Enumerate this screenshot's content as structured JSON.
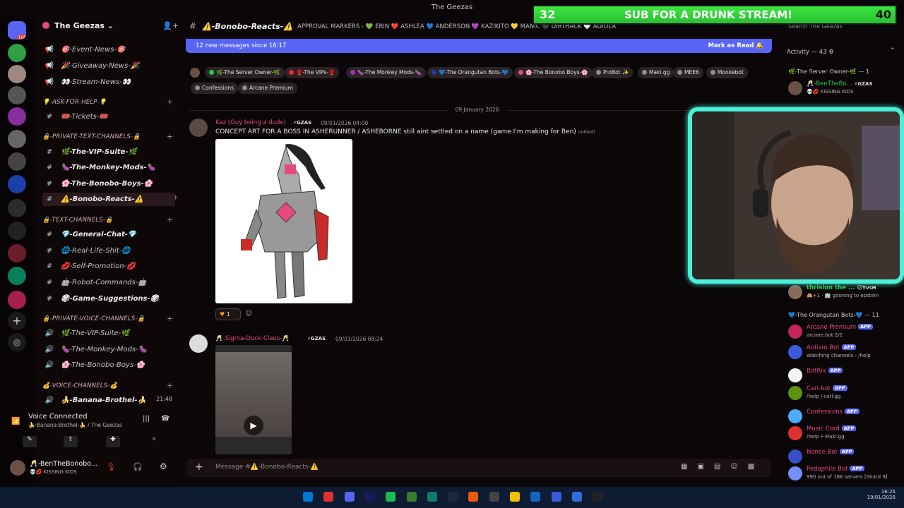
{
  "window_title": "The Geezas",
  "overlay": {
    "sub_left": "32",
    "sub_text": "SUB FOR A DRUNK STREAM!",
    "sub_right": "40"
  },
  "server": {
    "name": "The Geezas",
    "rail_badge": "108"
  },
  "sidebar": {
    "items": [
      {
        "type": "channel",
        "icon": "📢",
        "label": "🎯-Event-News-🎯",
        "dim": true
      },
      {
        "type": "channel",
        "icon": "📢",
        "label": "🎉-Giveaway-News-🎉",
        "dim": true
      },
      {
        "type": "channel",
        "icon": "📢",
        "label": "👀-Stream-News-👀",
        "dim": true
      },
      {
        "type": "category",
        "label": "💡-ASK-FOR-HELP-💡"
      },
      {
        "type": "channel",
        "icon": "#",
        "label": "🎟️-Tickets-🎟️",
        "dim": true
      },
      {
        "type": "category",
        "label": "🔒-PRIVATE-TEXT-CHANNELS-🔒"
      },
      {
        "type": "channel",
        "icon": "#",
        "label": "🌿-The-VIP-Suite-🌿"
      },
      {
        "type": "channel",
        "icon": "#",
        "label": "🍆-The-Monkey-Mods-🍆"
      },
      {
        "type": "channel",
        "icon": "#",
        "label": "🌸-The-Bonobo-Boys-🌸"
      },
      {
        "type": "channel",
        "icon": "#",
        "label": "⚠️-Bonobo-Reacts-⚠️",
        "active": true
      },
      {
        "type": "category",
        "label": "🔒-TEXT-CHANNELS-🔒"
      },
      {
        "type": "channel",
        "icon": "#",
        "label": "💎-General-Chat-💎"
      },
      {
        "type": "channel",
        "icon": "#",
        "label": "🌐-Real-Life-Shit-🌐",
        "dim": true
      },
      {
        "type": "channel",
        "icon": "#",
        "label": "💋-Self-Promotion-💋",
        "dim": true
      },
      {
        "type": "channel",
        "icon": "#",
        "label": "🤖-Robot-Commands-🤖",
        "dim": true
      },
      {
        "type": "channel",
        "icon": "#",
        "label": "🎲-Game-Suggestions-🎲"
      },
      {
        "type": "category",
        "label": "🔒-PRIVATE-VOICE-CHANNELS-🔒"
      },
      {
        "type": "channel",
        "icon": "🔊",
        "label": "🌿-The-VIP-Suite-🌿",
        "dim": true
      },
      {
        "type": "channel",
        "icon": "🔊",
        "label": "🍆-The-Monkey-Mods-🍆",
        "dim": true
      },
      {
        "type": "channel",
        "icon": "🔊",
        "label": "🌸-The-Bonobo-Boys-🌸",
        "dim": true
      },
      {
        "type": "category",
        "label": "💰-VOICE-CHANNELS-💰"
      },
      {
        "type": "channel",
        "icon": "🔊",
        "label": "🍌-Banana-Brothel-🍌"
      }
    ],
    "voice_time": "21:48"
  },
  "voice": {
    "status": "Voice Connected",
    "location": "🍌-Banana-Brothel-🍌 / The Geezas"
  },
  "user": {
    "name": "🥂-BenTheBonobo...",
    "status": "💀💋 KISSING KIDS"
  },
  "header": {
    "channel": "⚠️-Bonobo-Reacts-⚠️",
    "topic": "APPROVAL MARKERS - 💚 ERIN ❤️ ASHLEA 💙 ANDERSON 💜 KAZIKITO 💛 MANIC 🖤 DIRTHACK 🤍 ADIOLA",
    "search_placeholder": "Search The Geezas"
  },
  "new_messages": {
    "text": "12 new messages since 16:17",
    "action": "Mark as Read"
  },
  "role_pills": [
    {
      "label": "🌿-The Server Owner-🌿",
      "color": "#2dc653"
    },
    {
      "label": "🥊-The VIPs-🥊",
      "color": "#e03131"
    },
    {
      "label": "🍆-The Monkey Mods-🍆",
      "color": "#9c36b5"
    },
    {
      "label": "💙-The Orangutan Bots-💙",
      "color": "#1c3faa"
    },
    {
      "label": "🌸-The Bonobo Boys-🌸",
      "color": "#e64980"
    },
    {
      "label": "ProBot ✨",
      "color": "#868e96"
    },
    {
      "label": "Maki.gg",
      "color": "#868e96"
    },
    {
      "label": "MEE6",
      "color": "#868e96"
    },
    {
      "label": "Monkebot",
      "color": "#868e96"
    },
    {
      "label": "Confessions",
      "color": "#868e96"
    },
    {
      "label": "Arcane Premium",
      "color": "#868e96"
    }
  ],
  "date_separator": "09 January 2026",
  "messages": [
    {
      "author": "Kaz (Guy being a dude)",
      "tag": "⚡GZAS",
      "time": "09/01/2026 04:00",
      "text": "CONCEPT ART FOR A BOSS IN ASHERUNNER / ASHEBORNE still aint settled on a name (game I'm making for Ben)",
      "edited": "(edited)",
      "reaction_count": "1"
    },
    {
      "author": "🥂-Sigma-Duck-Claus-🥂",
      "tag": "⚡GZAS",
      "time": "09/01/2026 08:24"
    }
  ],
  "composer": {
    "placeholder": "Message #⚠️-Bonobo-Reacts-⚠️"
  },
  "members": {
    "activity": "Activity — 43",
    "owner_group": "🌿-The Server Owner-🌿 — 1",
    "owner": {
      "name": "🥂-BenTheBo...",
      "tag": "⚡GZAS",
      "status": "💀💋 KISSING KIDS"
    },
    "partial": {
      "name": "thrision the ...",
      "tag": "🐱YvsH",
      "status": "🙈+1 · 🏢 gooning to epstein"
    },
    "bots_group": "💙-The Orangutan Bots-💙 — 11",
    "bots": [
      {
        "name": "Arcane Premium",
        "sub": "arcane.bot 2/2",
        "color": "#e64980",
        "av": "#c2255c"
      },
      {
        "name": "Autism Bot",
        "sub": "Watching channels - /help",
        "color": "#e64980",
        "av": "#3b5bdb"
      },
      {
        "name": "BotRix",
        "sub": "",
        "color": "#e64980",
        "av": "#f1f3f5"
      },
      {
        "name": "Carl-bot",
        "sub": "/help | carl.gg",
        "color": "#e64980",
        "av": "#5c940d"
      },
      {
        "name": "Confessions",
        "sub": "",
        "color": "#e64980",
        "av": "#4dabf7"
      },
      {
        "name": "Music Cord",
        "sub": "/help • Maki.gg",
        "color": "#e64980",
        "av": "#e03131"
      },
      {
        "name": "Nonce Bot",
        "sub": "",
        "color": "#e64980",
        "av": "#364fc7"
      },
      {
        "name": "Pedophile Bot",
        "sub": "990 out of 18K servers [Shard 9]",
        "color": "#e64980",
        "av": "#748ffc"
      }
    ],
    "app_label": "APP"
  },
  "taskbar": {
    "time": "16:25",
    "date": "19/01/2026"
  }
}
